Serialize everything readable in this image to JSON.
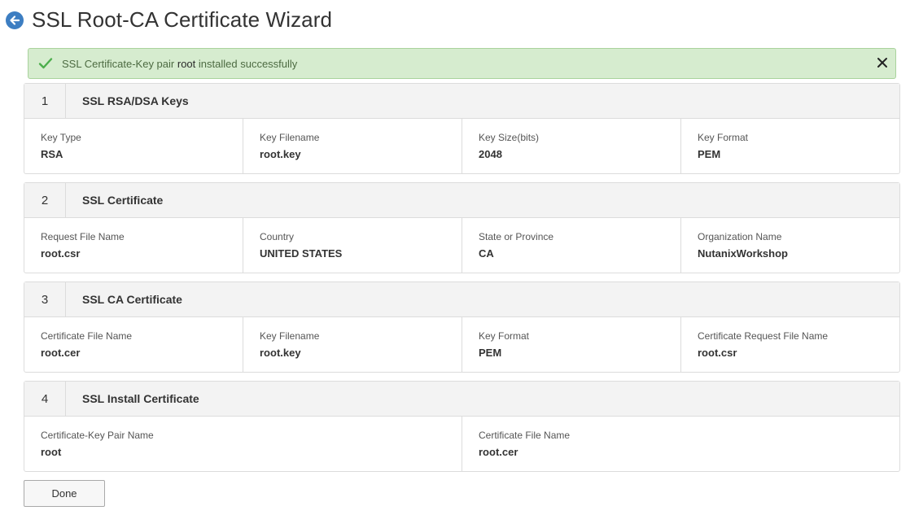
{
  "page": {
    "title": "SSL Root-CA Certificate Wizard"
  },
  "banner": {
    "prefix": "SSL Certificate-Key pair",
    "highlight": "root",
    "suffix": "installed successfully"
  },
  "sections": [
    {
      "number": "1",
      "title": "SSL RSA/DSA Keys",
      "fields": [
        {
          "label": "Key Type",
          "value": "RSA"
        },
        {
          "label": "Key Filename",
          "value": "root.key"
        },
        {
          "label": "Key Size(bits)",
          "value": "2048"
        },
        {
          "label": "Key Format",
          "value": "PEM"
        }
      ]
    },
    {
      "number": "2",
      "title": "SSL Certificate",
      "fields": [
        {
          "label": "Request File Name",
          "value": "root.csr"
        },
        {
          "label": "Country",
          "value": "UNITED STATES"
        },
        {
          "label": "State or Province",
          "value": "CA"
        },
        {
          "label": "Organization Name",
          "value": "NutanixWorkshop"
        }
      ]
    },
    {
      "number": "3",
      "title": "SSL CA Certificate",
      "fields": [
        {
          "label": "Certificate File Name",
          "value": "root.cer"
        },
        {
          "label": "Key Filename",
          "value": "root.key"
        },
        {
          "label": "Key Format",
          "value": "PEM"
        },
        {
          "label": "Certificate Request File Name",
          "value": "root.csr"
        }
      ]
    },
    {
      "number": "4",
      "title": "SSL Install Certificate",
      "fields": [
        {
          "label": "Certificate-Key Pair Name",
          "value": "root"
        },
        {
          "label": "Certificate File Name",
          "value": "root.cer"
        }
      ]
    }
  ],
  "footer": {
    "done_label": "Done"
  },
  "colors": {
    "accent": "#3d7ec2",
    "success_bg": "#d6eccf",
    "success_check": "#4cae4c"
  },
  "icons": {
    "back": "arrow-left-icon",
    "success": "checkmark-icon",
    "close": "close-icon"
  }
}
